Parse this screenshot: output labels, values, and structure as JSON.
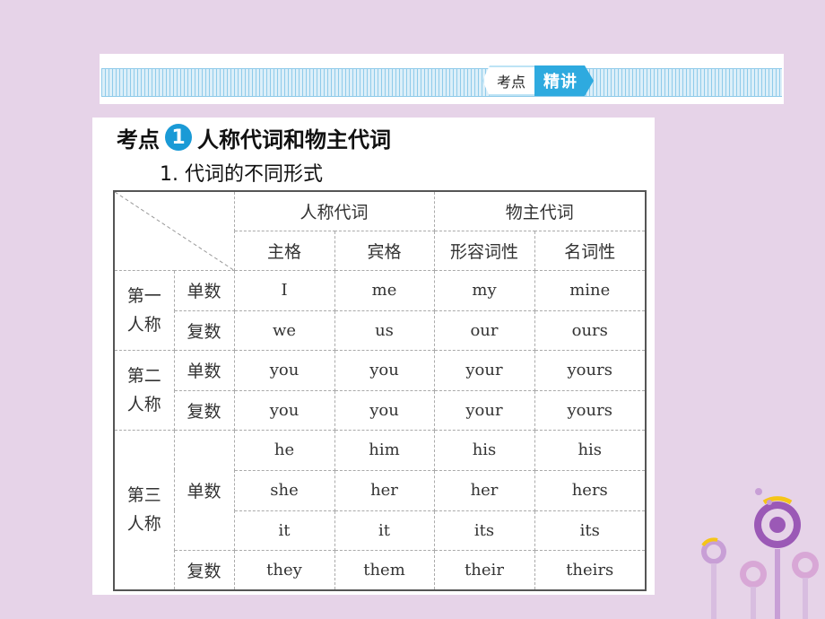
{
  "banner": {
    "tag_left": "考点",
    "tag_right": "精讲"
  },
  "heading": {
    "prefix": "考点",
    "number": "1",
    "title": "人称代词和物主代词"
  },
  "subheading": "1. 代词的不同形式",
  "table": {
    "group_headers": [
      "人称代词",
      "物主代词"
    ],
    "sub_headers": [
      "主格",
      "宾格",
      "形容词性",
      "名词性"
    ],
    "persons": [
      {
        "label_line1": "第一",
        "label_line2": "人称",
        "rows": [
          {
            "number": "单数",
            "cells": [
              "I",
              "me",
              "my",
              "mine"
            ]
          },
          {
            "number": "复数",
            "cells": [
              "we",
              "us",
              "our",
              "ours"
            ]
          }
        ]
      },
      {
        "label_line1": "第二",
        "label_line2": "人称",
        "rows": [
          {
            "number": "单数",
            "cells": [
              "you",
              "you",
              "your",
              "yours"
            ]
          },
          {
            "number": "复数",
            "cells": [
              "you",
              "you",
              "your",
              "yours"
            ]
          }
        ]
      },
      {
        "label_line1": "第三",
        "label_line2": "人称",
        "singular_label": "单数",
        "singular_rows": [
          [
            "he",
            "him",
            "his",
            "his"
          ],
          [
            "she",
            "her",
            "her",
            "hers"
          ],
          [
            "it",
            "it",
            "its",
            "its"
          ]
        ],
        "plural_label": "复数",
        "plural_row": [
          "they",
          "them",
          "their",
          "theirs"
        ]
      }
    ]
  },
  "colors": {
    "background": "#e6d3e8",
    "accent": "#2eaadf",
    "number_badge": "#1a9ad6"
  }
}
